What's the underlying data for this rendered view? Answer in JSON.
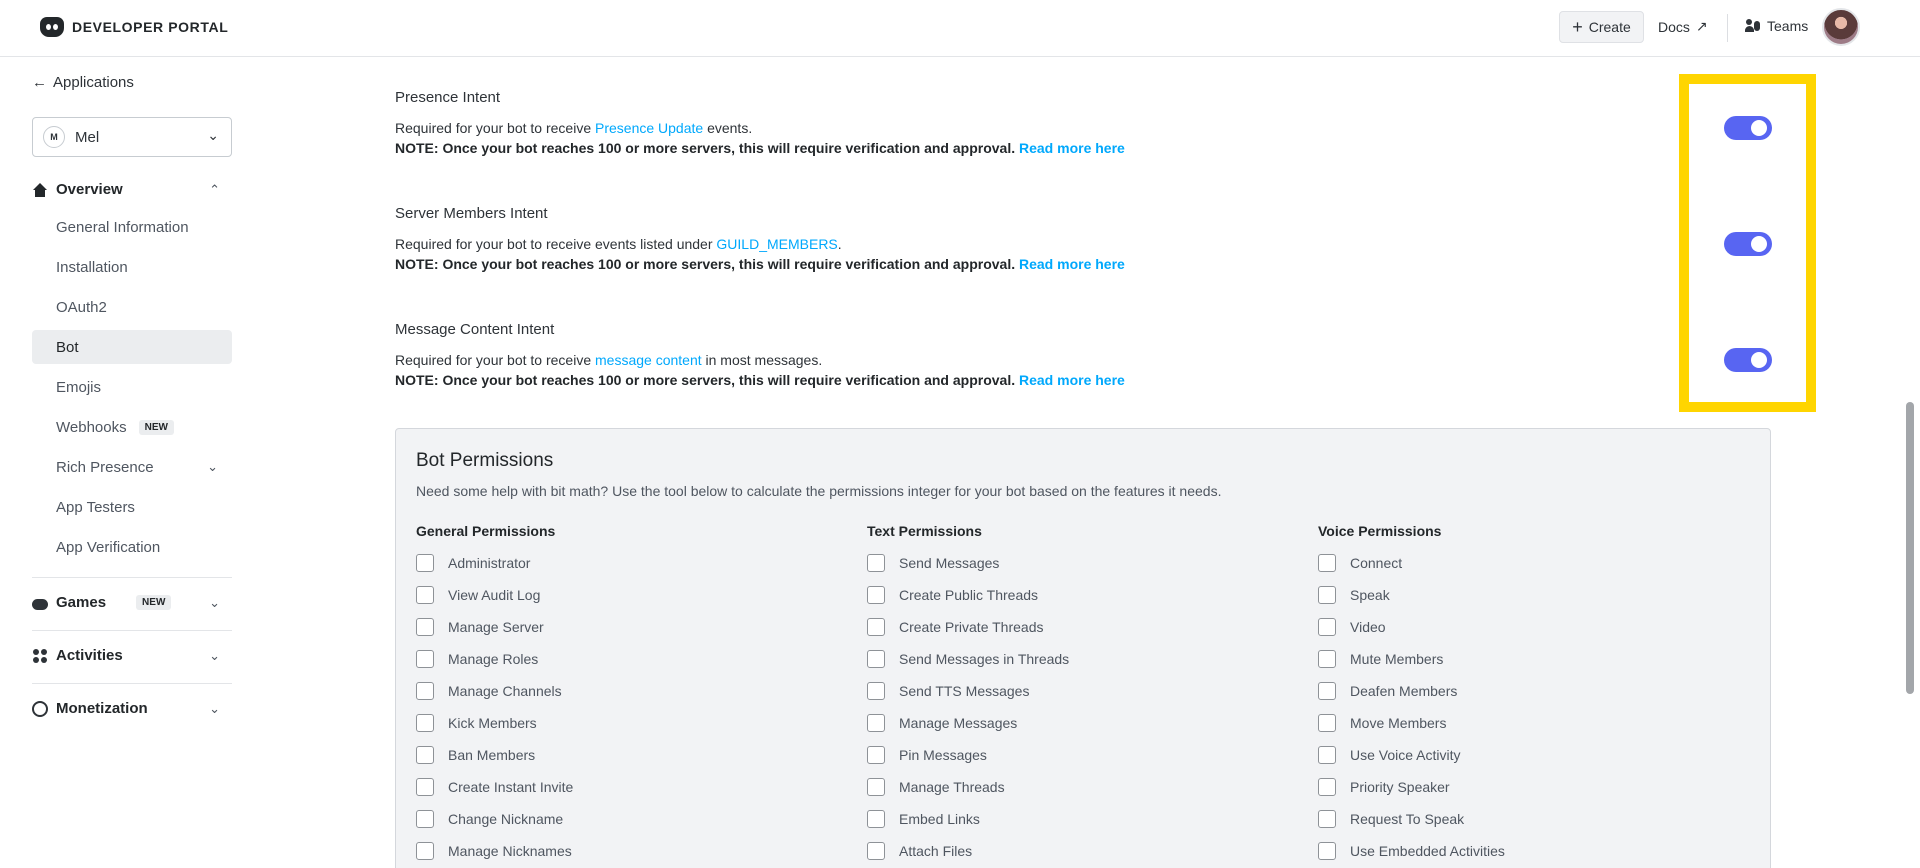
{
  "header": {
    "logo_text": "DEVELOPER PORTAL",
    "create_label": "Create",
    "docs_label": "Docs",
    "teams_label": "Teams"
  },
  "sidebar": {
    "back_label": "Applications",
    "app_selector": {
      "badge": "M",
      "name": "Mel"
    },
    "overview_label": "Overview",
    "items": [
      {
        "label": "General Information"
      },
      {
        "label": "Installation"
      },
      {
        "label": "OAuth2"
      },
      {
        "label": "Bot",
        "active": true
      },
      {
        "label": "Emojis"
      },
      {
        "label": "Webhooks",
        "badge": "NEW"
      },
      {
        "label": "Rich Presence"
      },
      {
        "label": "App Testers"
      },
      {
        "label": "App Verification"
      }
    ],
    "games_label": "Games",
    "games_badge": "NEW",
    "activities_label": "Activities",
    "monetization_label": "Monetization"
  },
  "intents": [
    {
      "title": "Presence Intent",
      "desc_pre": "Required for your bot to receive ",
      "desc_link": "Presence Update",
      "desc_post": " events.",
      "note": "NOTE: Once your bot reaches 100 or more servers, this will require verification and approval.",
      "note_link": "Read more here",
      "enabled": true
    },
    {
      "title": "Server Members Intent",
      "desc_pre": "Required for your bot to receive events listed under ",
      "desc_link": "GUILD_MEMBERS",
      "desc_post": ".",
      "note": "NOTE: Once your bot reaches 100 or more servers, this will require verification and approval.",
      "note_link": "Read more here",
      "enabled": true
    },
    {
      "title": "Message Content Intent",
      "desc_pre": "Required for your bot to receive ",
      "desc_link": "message content",
      "desc_post": " in most messages.",
      "note": "NOTE: Once your bot reaches 100 or more servers, this will require verification and approval.",
      "note_link": "Read more here",
      "enabled": true
    }
  ],
  "permissions": {
    "title": "Bot Permissions",
    "desc": "Need some help with bit math? Use the tool below to calculate the permissions integer for your bot based on the features it needs.",
    "columns": [
      {
        "title": "General Permissions",
        "items": [
          "Administrator",
          "View Audit Log",
          "Manage Server",
          "Manage Roles",
          "Manage Channels",
          "Kick Members",
          "Ban Members",
          "Create Instant Invite",
          "Change Nickname",
          "Manage Nicknames"
        ]
      },
      {
        "title": "Text Permissions",
        "items": [
          "Send Messages",
          "Create Public Threads",
          "Create Private Threads",
          "Send Messages in Threads",
          "Send TTS Messages",
          "Manage Messages",
          "Pin Messages",
          "Manage Threads",
          "Embed Links",
          "Attach Files"
        ]
      },
      {
        "title": "Voice Permissions",
        "items": [
          "Connect",
          "Speak",
          "Video",
          "Mute Members",
          "Deafen Members",
          "Move Members",
          "Use Voice Activity",
          "Priority Speaker",
          "Request To Speak",
          "Use Embedded Activities"
        ]
      }
    ]
  },
  "colors": {
    "accent": "#5865f2",
    "link": "#00a8fc",
    "highlight": "#ffd500"
  }
}
